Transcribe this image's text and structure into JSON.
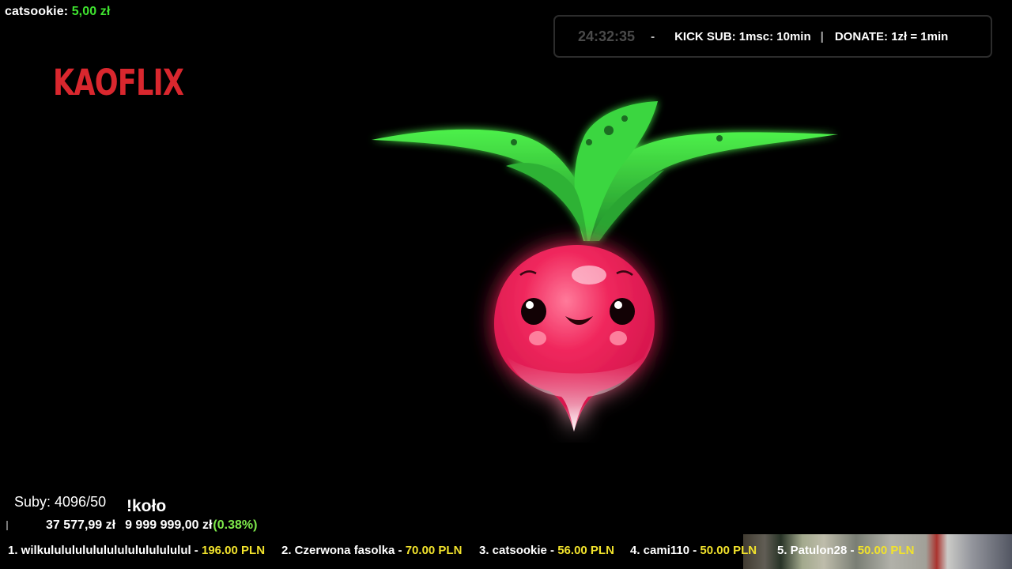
{
  "last_donation": {
    "name": "catsookie:",
    "amount": "5,00 zł"
  },
  "logo": "KAOFLIX",
  "info_bar": {
    "timer": "24:32:35",
    "dash": "-",
    "kick_sub": "KICK SUB: 1msc: 10min",
    "separator": "|",
    "donate": "DONATE: 1zł = 1min"
  },
  "stats": {
    "subs": "Suby: 4096/50",
    "kolo": "!koło",
    "goal_current": "37 577,99 zł",
    "goal_target": "9 999 999,00 zł",
    "goal_percent": "(0.38%)"
  },
  "top_donors": [
    {
      "label": "1. wilkulululululululululululululul - ",
      "amount": "196.00 PLN"
    },
    {
      "label": "2. Czerwona fasolka - ",
      "amount": "70.00 PLN"
    },
    {
      "label": "3. catsookie - ",
      "amount": "56.00 PLN"
    },
    {
      "label": "4. cami110 - ",
      "amount": "50.00 PLN"
    },
    {
      "label": "5. Patulon28 - ",
      "amount": "50.00 PLN"
    }
  ],
  "colors": {
    "accent_green": "#3fe32f",
    "logo_red": "#d9272e",
    "pln_yellow": "#f1e22c",
    "radish_red": "#e8245a",
    "leaf_green": "#36d33a"
  },
  "icons": [
    "radish-mascot"
  ]
}
